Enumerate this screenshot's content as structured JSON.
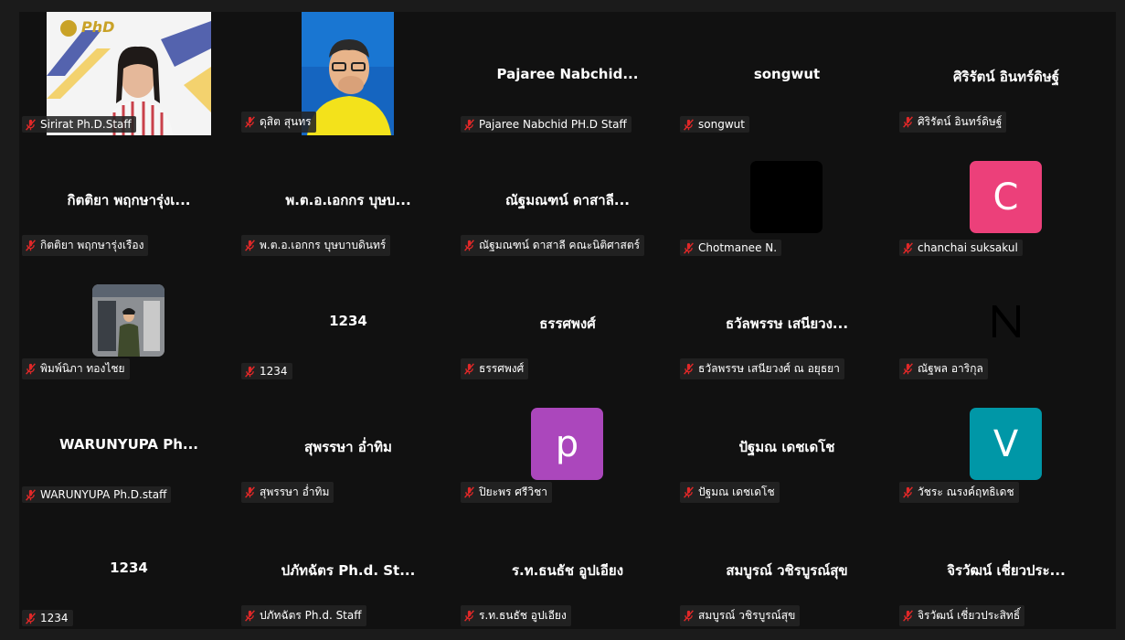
{
  "participants": [
    {
      "center": "",
      "label": "Sirirat Ph.D.Staff"
    },
    {
      "center": "",
      "label": "ดุสิต สุนทร"
    },
    {
      "center": "Pajaree Nabchid...",
      "label": "Pajaree Nabchid PH.D Staff"
    },
    {
      "center": "songwut",
      "label": "songwut"
    },
    {
      "center": "ศิริรัตน์ อินทร์ดิษฐ์",
      "label": "ศิริรัตน์ อินทร์ดิษฐ์"
    },
    {
      "center": "กิตติยา พฤกษารุ่งเ...",
      "label": "กิตติยา พฤกษารุ่งเรือง"
    },
    {
      "center": "พ.ต.อ.เอกกร บุษบ...",
      "label": "พ.ต.อ.เอกกร บุษบาบดินทร์"
    },
    {
      "center": "ณัฐมณฑน์ ดาสาลี...",
      "label": "ณัฐมณฑน์ ดาสาลี คณะนิติศาสตร์"
    },
    {
      "center": "",
      "label": "Chotmanee N."
    },
    {
      "center": "",
      "label": "chanchai suksakul",
      "avatar_letter": "C",
      "avatar_color": "#ec407a"
    },
    {
      "center": "",
      "label": "พิมพ์นิภา ทองไชย"
    },
    {
      "center": "1234",
      "label": "1234"
    },
    {
      "center": "ธรรศพงศ์",
      "label": "ธรรศพงศ์"
    },
    {
      "center": "ธวัลพรรษ เสนียวง...",
      "label": "ธวัลพรรษ เสนียวงศ์ ณ อยุธยา"
    },
    {
      "center": "",
      "label": "ณัฐพล อาริกุล",
      "avatar_letter": "N",
      "avatar_color": "#42a5f5"
    },
    {
      "center": "WARUNYUPA Ph...",
      "label": "WARUNYUPA Ph.D.staff"
    },
    {
      "center": "สุพรรษา อ่ำทิม",
      "label": "สุพรรษา อ่ำทิม"
    },
    {
      "center": "",
      "label": "ปิยะพร ศรีวิชา",
      "avatar_letter": "p",
      "avatar_color": "#ab47bc"
    },
    {
      "center": "ปัฐมณ เดชเดโช",
      "label": "ปัฐมณ เดชเดโช"
    },
    {
      "center": "",
      "label": "วัชระ ณรงค์ฤทธิเดช",
      "avatar_letter": "V",
      "avatar_color": "#0097a7"
    },
    {
      "center": "1234",
      "label": "1234"
    },
    {
      "center": "ปภัทฉัตร Ph.d. St...",
      "label": "ปภัทฉัตร Ph.d. Staff"
    },
    {
      "center": "ร.ท.ธนธัช อูปเอียง",
      "label": "ร.ท.ธนธัช อูปเอียง"
    },
    {
      "center": "สมบูรณ์ วชิรบูรณ์สุข",
      "label": "สมบูรณ์ วชิรบูรณ์สุข"
    },
    {
      "center": "จิรวัฒน์ เชี่ยวประ...",
      "label": "จิรวัฒน์ เชี่ยวประสิทธิ์"
    }
  ],
  "video_1": {
    "logo_text": "PhD"
  },
  "colors": {
    "mute_icon": "#e02828",
    "tile_background": "#111111"
  }
}
